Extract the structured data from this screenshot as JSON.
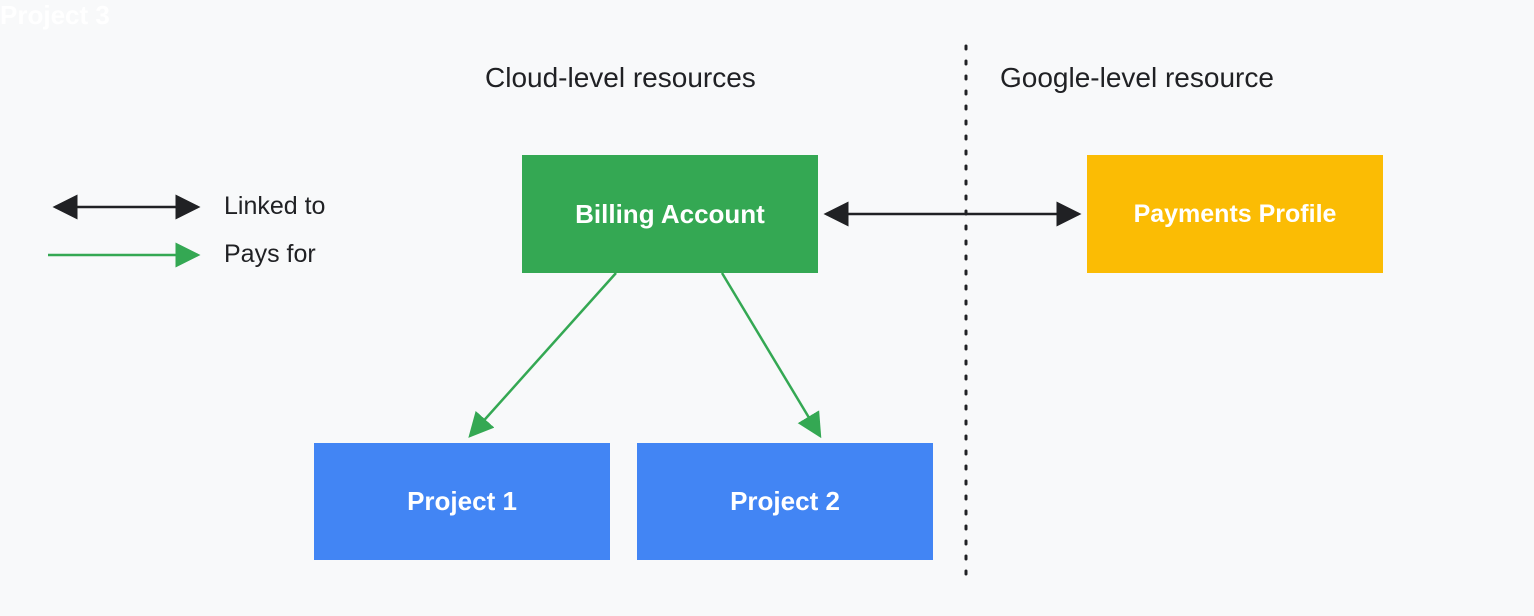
{
  "headings": {
    "cloud": "Cloud-level resources",
    "google": "Google-level resource"
  },
  "boxes": {
    "billing": "Billing Account",
    "payments": "Payments Profile",
    "project1": "Project 1",
    "project2": "Project 2",
    "project3": "Project 3"
  },
  "legend": {
    "linked": "Linked to",
    "pays": "Pays for"
  },
  "colors": {
    "green": "#34a853",
    "yellow": "#fbbc04",
    "blue": "#4285f4",
    "black": "#202124",
    "background": "#f8f9fa"
  },
  "diagram": {
    "relationships": [
      {
        "from": "Billing Account",
        "to": "Payments Profile",
        "type": "linked"
      },
      {
        "from": "Billing Account",
        "to": "Project 1",
        "type": "pays"
      },
      {
        "from": "Billing Account",
        "to": "Project 2",
        "type": "pays"
      }
    ]
  }
}
